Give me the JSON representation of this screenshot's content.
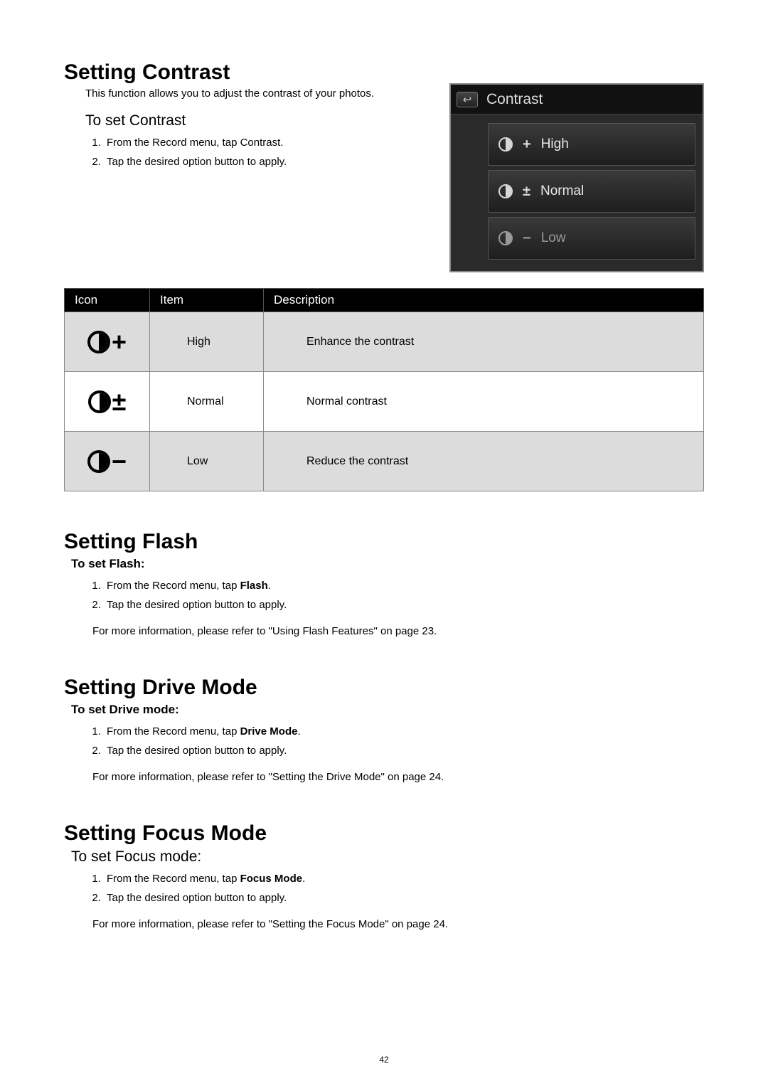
{
  "page_number": "42",
  "s1": {
    "heading": "Setting Contrast",
    "intro": "This function allows you to adjust the contrast of your photos.",
    "sub": "To set Contrast",
    "steps": [
      "From the Record menu, tap Contrast.",
      "Tap the desired option button to apply."
    ]
  },
  "cam": {
    "title": "Contrast",
    "options": [
      {
        "sign": "+",
        "label": "High"
      },
      {
        "sign": "±",
        "label": "Normal"
      },
      {
        "sign": "−",
        "label": "Low"
      }
    ]
  },
  "table": {
    "headers": {
      "icon": "Icon",
      "item": "Item",
      "desc": "Description"
    },
    "rows": [
      {
        "sign": "+",
        "item": "High",
        "desc": "Enhance the contrast"
      },
      {
        "sign": "±",
        "item": "Normal",
        "desc": "Normal contrast"
      },
      {
        "sign": "−",
        "item": "Low",
        "desc": "Reduce the contrast"
      }
    ]
  },
  "s2": {
    "heading": "Setting Flash",
    "sub": "To set Flash:",
    "step1_pre": "From the Record menu, tap ",
    "step1_bold": "Flash",
    "step1_post": ".",
    "step2": "Tap the desired option button to apply.",
    "note": "For more information, please refer to \"Using Flash Features\" on page 23."
  },
  "s3": {
    "heading": "Setting Drive Mode",
    "sub": "To set Drive mode:",
    "step1_pre": "From the Record menu, tap ",
    "step1_bold": "Drive Mode",
    "step1_post": ".",
    "step2": "Tap the desired option button to apply.",
    "note": "For more information, please refer to \"Setting the Drive Mode\" on page 24."
  },
  "s4": {
    "heading": "Setting Focus Mode",
    "sub": "To set Focus mode:",
    "step1_pre": "From the Record menu, tap ",
    "step1_bold": "Focus Mode",
    "step1_post": ".",
    "step2": "Tap the desired option button to apply.",
    "note": "For more information, please refer to \"Setting the Focus Mode\" on page 24."
  }
}
